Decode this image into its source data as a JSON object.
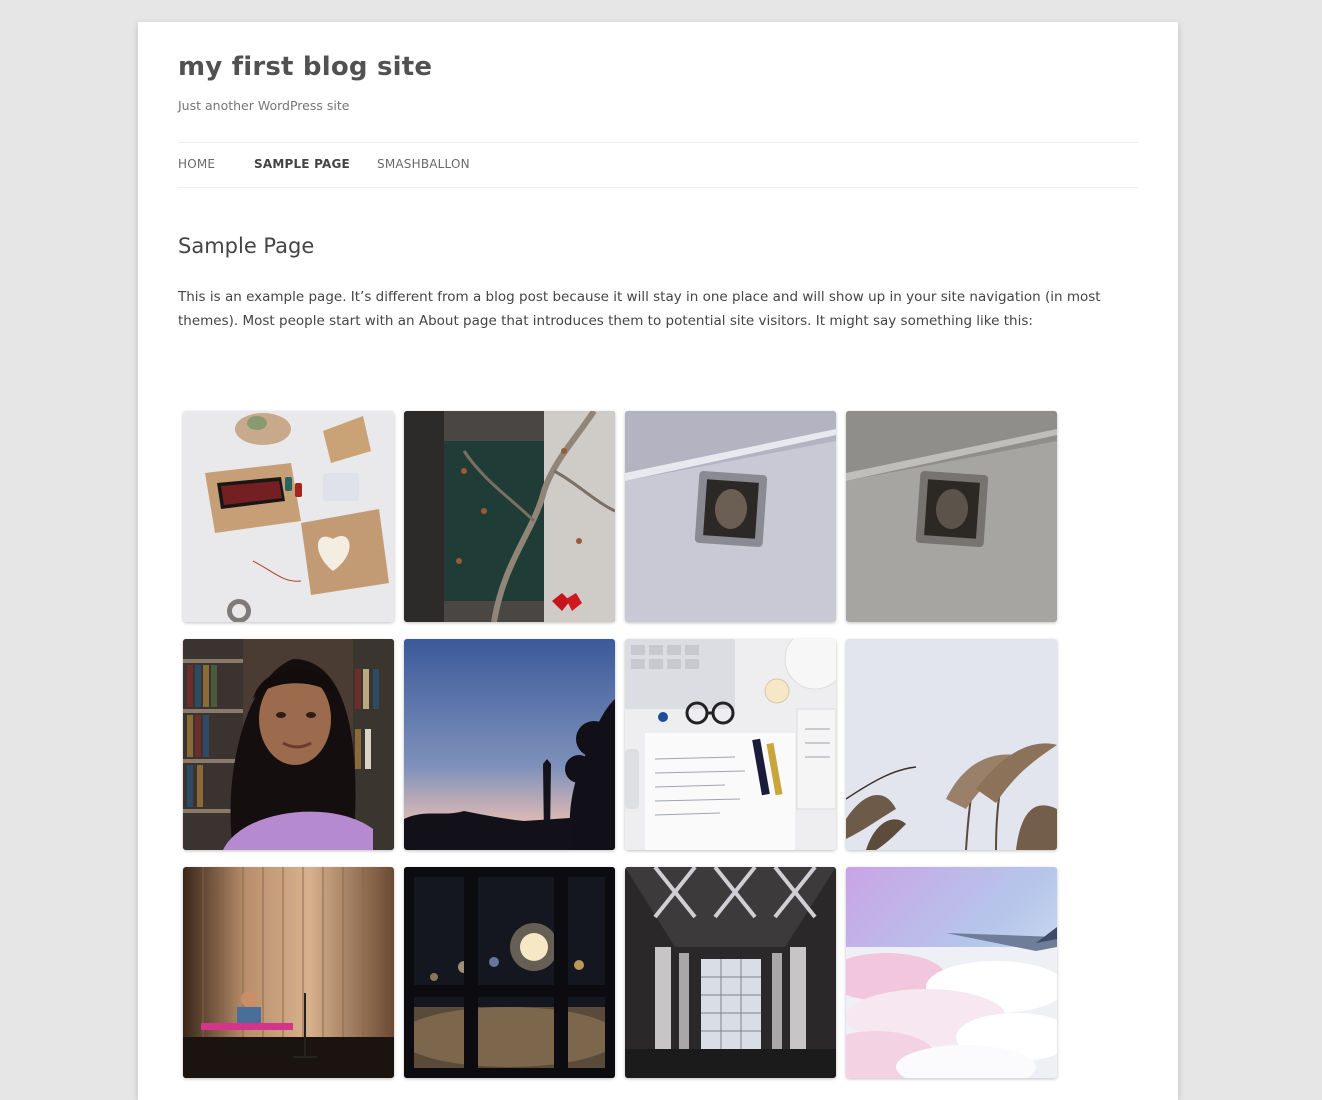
{
  "site": {
    "title": "my first blog site",
    "description": "Just another WordPress site"
  },
  "nav": {
    "items": [
      {
        "label": "Home",
        "current": false
      },
      {
        "label": "Sample Page",
        "current": true
      },
      {
        "label": "Smashballon",
        "current": false
      }
    ]
  },
  "page": {
    "title": "Sample Page",
    "body": "This is an example page. It’s different from a blog post because it will stay in one place and will show up in your site navigation (in most themes). Most people start with an About page that introduces them to potential site visitors. It might say something like this:"
  },
  "instagram_feed": {
    "photos": [
      {
        "subject": "craft cards flat lay"
      },
      {
        "subject": "ivy covered window"
      },
      {
        "subject": "framed picture on wall"
      },
      {
        "subject": "framed picture on wall dim"
      },
      {
        "subject": "selfie in library"
      },
      {
        "subject": "monument at dusk"
      },
      {
        "subject": "desk with notes and glasses"
      },
      {
        "subject": "pampas grass against sky"
      },
      {
        "subject": "musician on stage"
      },
      {
        "subject": "night window bokeh"
      },
      {
        "subject": "atrium architecture"
      },
      {
        "subject": "clouds from airplane window"
      }
    ]
  }
}
